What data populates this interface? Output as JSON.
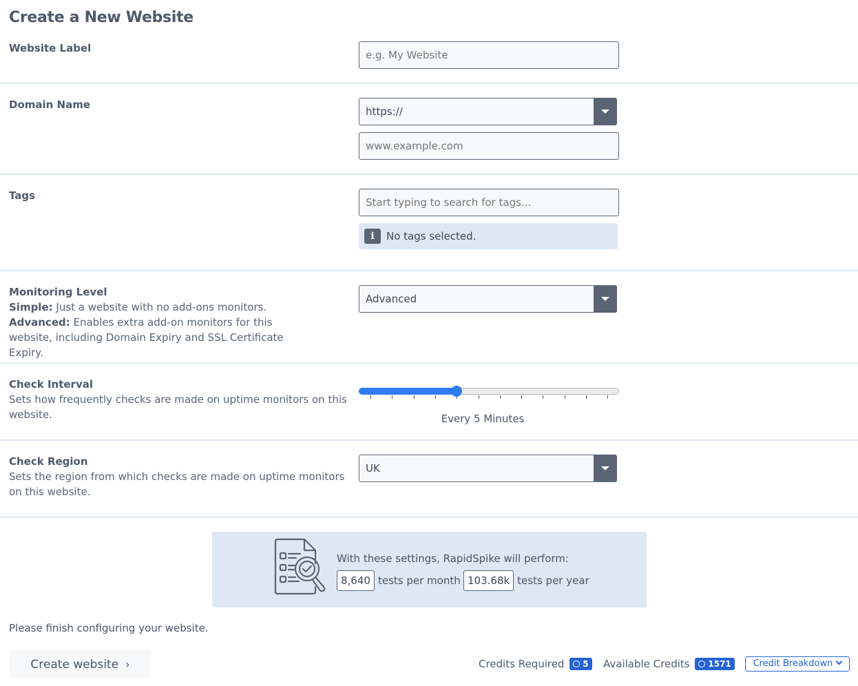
{
  "page": {
    "title": "Create a New Website"
  },
  "form": {
    "website_label": {
      "label": "Website Label",
      "value": "",
      "placeholder": "e.g. My Website"
    },
    "domain_name": {
      "label": "Domain Name",
      "protocol_selected": "https://",
      "domain_value": "",
      "domain_placeholder": "www.example.com"
    },
    "tags": {
      "label": "Tags",
      "placeholder": "Start typing to search for tags...",
      "info_icon": "info-icon",
      "empty_message": "No tags selected."
    },
    "monitoring_level": {
      "label": "Monitoring Level",
      "simple_term": "Simple:",
      "simple_desc": " Just a website with no add-ons monitors.",
      "advanced_term": "Advanced:",
      "advanced_desc": " Enables extra add-on monitors for this website, including Domain Expiry and SSL Certificate Expiry.",
      "selected": "Advanced"
    },
    "check_interval": {
      "label": "Check Interval",
      "description": "Sets how frequently checks are made on uptime monitors on this website.",
      "slider_steps": 12,
      "slider_index": 4,
      "value_text": "Every 5 Minutes"
    },
    "check_region": {
      "label": "Check Region",
      "description": "Sets the region from which checks are made on uptime monitors on this website.",
      "selected": "UK"
    }
  },
  "summary": {
    "icon": "document-search-check-icon",
    "lead": "With these settings, RapidSpike will perform:",
    "tests_per_month": "8,640",
    "tests_per_month_label": "tests per month",
    "tests_per_year": "103.68k",
    "tests_per_year_label": "tests per year"
  },
  "footer": {
    "status_message": "Please finish configuring your website.",
    "create_button": "Create website",
    "credits_required_label": "Credits Required",
    "credits_required_value": "5",
    "available_credits_label": "Available Credits",
    "available_credits_value": "1571",
    "breakdown_button": "Credit Breakdown",
    "badge_color": "#2463d6",
    "slider_color": "#2f7cf0"
  }
}
